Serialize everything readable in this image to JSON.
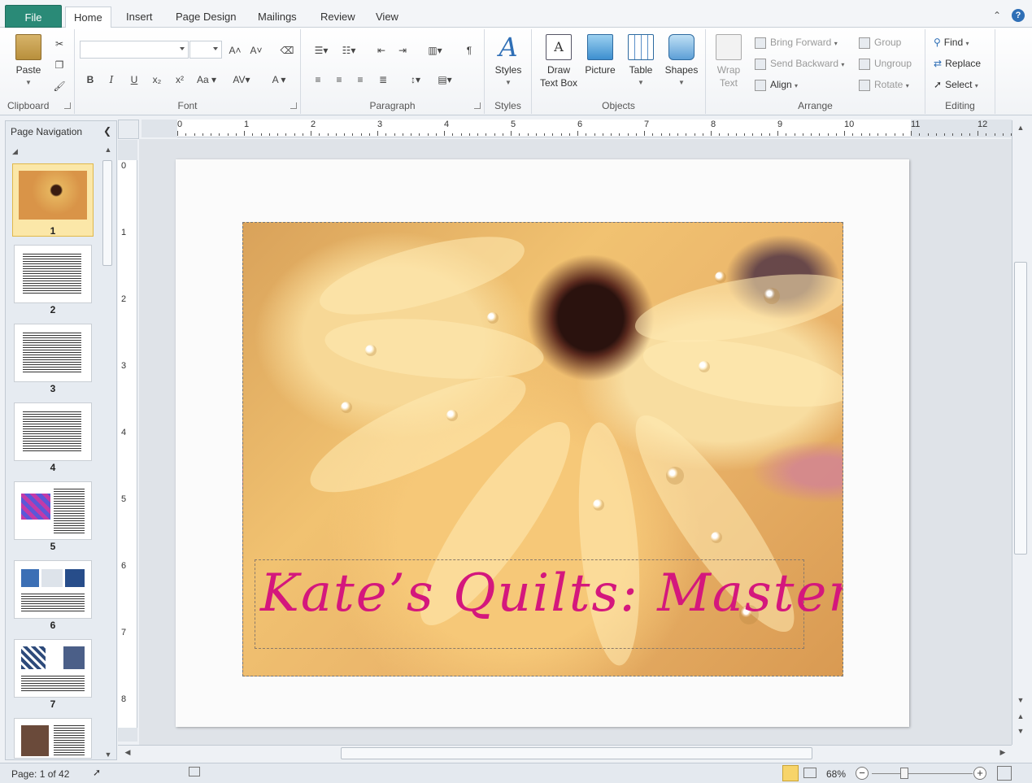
{
  "tabs": {
    "file": "File",
    "items": [
      "Home",
      "Insert",
      "Page Design",
      "Mailings",
      "Review",
      "View"
    ]
  },
  "ribbon": {
    "clipboard": {
      "label": "Clipboard",
      "paste": "Paste"
    },
    "font": {
      "label": "Font"
    },
    "paragraph": {
      "label": "Paragraph",
      "show_marks": "¶"
    },
    "styles": {
      "label": "Styles",
      "styles_btn": "Styles"
    },
    "objects": {
      "label": "Objects",
      "draw_text_box_1": "Draw",
      "draw_text_box_2": "Text Box",
      "picture": "Picture",
      "table": "Table",
      "shapes": "Shapes"
    },
    "arrange": {
      "label": "Arrange",
      "wrap_text_1": "Wrap",
      "wrap_text_2": "Text",
      "bring_forward": "Bring Forward",
      "send_backward": "Send Backward",
      "align": "Align",
      "group": "Group",
      "ungroup": "Ungroup",
      "rotate": "Rotate"
    },
    "editing": {
      "label": "Editing",
      "find": "Find",
      "replace": "Replace",
      "select": "Select"
    }
  },
  "nav": {
    "title": "Page Navigation",
    "pages": [
      "1",
      "2",
      "3",
      "4",
      "5",
      "6",
      "7"
    ]
  },
  "ruler": {
    "h_numbers": [
      "0",
      "1",
      "2",
      "3",
      "4",
      "5",
      "6",
      "7",
      "8",
      "9",
      "10",
      "11",
      "12"
    ],
    "v_numbers": [
      "0",
      "1",
      "2",
      "3",
      "4",
      "5",
      "6",
      "7",
      "8"
    ]
  },
  "document": {
    "title_text": "Kate’s Quilts: Master"
  },
  "status": {
    "page": "Page: 1 of 42",
    "zoom": "68%"
  }
}
